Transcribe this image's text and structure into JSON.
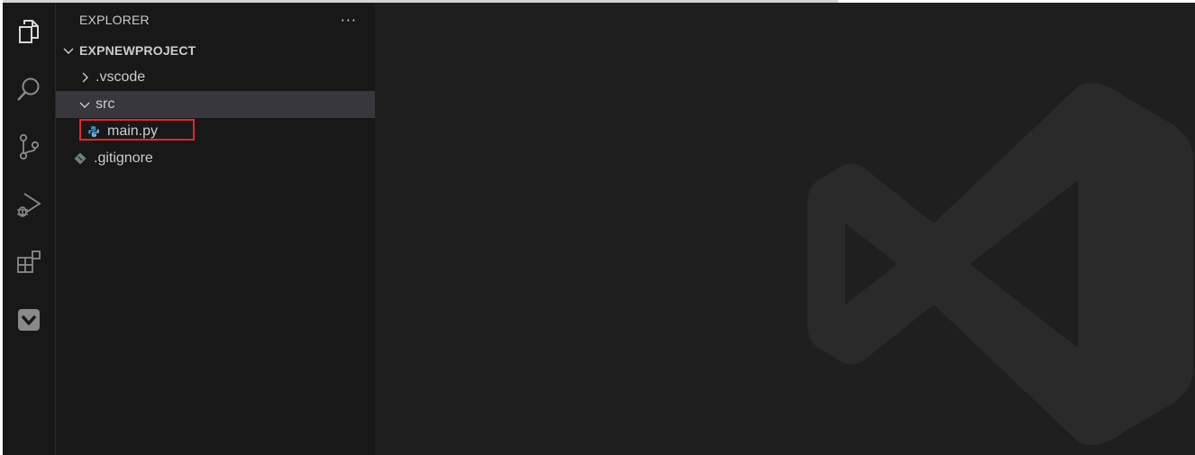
{
  "activity_bar": {
    "items": [
      {
        "name": "explorer",
        "icon": "files-icon",
        "active": true
      },
      {
        "name": "search",
        "icon": "search-icon",
        "active": false
      },
      {
        "name": "source-control",
        "icon": "source-control-icon",
        "active": false
      },
      {
        "name": "run-and-debug",
        "icon": "run-debug-icon",
        "active": false
      },
      {
        "name": "extensions",
        "icon": "extensions-icon",
        "active": false
      },
      {
        "name": "extension-panel",
        "icon": "chevron-box-icon",
        "active": false
      }
    ]
  },
  "sidebar": {
    "title": "EXPLORER",
    "more_actions": "···",
    "project": "EXPNEWPROJECT",
    "tree": [
      {
        "label": ".vscode",
        "type": "folder",
        "expanded": false
      },
      {
        "label": "src",
        "type": "folder",
        "expanded": true
      },
      {
        "label": "main.py",
        "type": "file",
        "icon": "python-icon"
      },
      {
        "label": ".gitignore",
        "type": "file",
        "icon": "git-icon"
      }
    ]
  },
  "colors": {
    "background": "#1f1f1f",
    "sidebar": "#181818",
    "selection": "#37373d",
    "highlight": "#e5252a",
    "watermark": "#2a2a2a"
  }
}
